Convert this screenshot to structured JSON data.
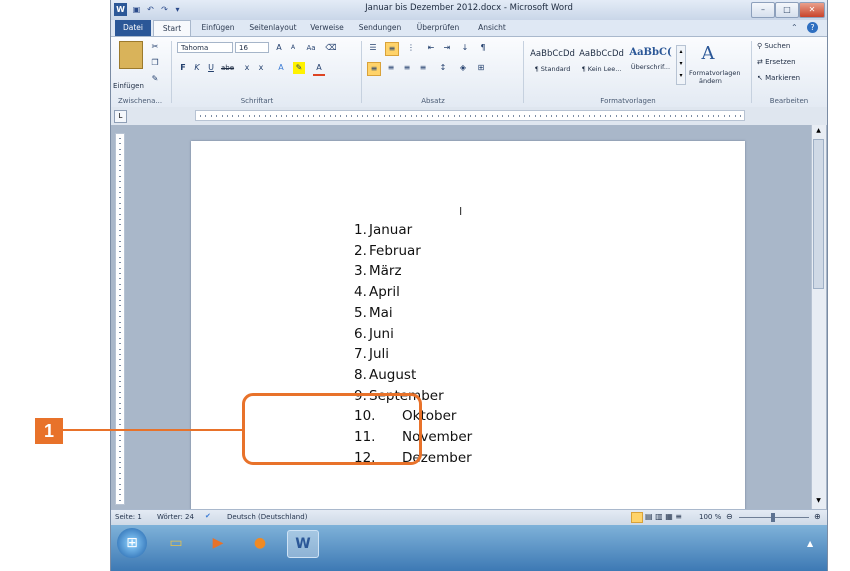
{
  "window": {
    "title": "Januar bis Dezember 2012.docx - Microsoft Word",
    "controls": [
      "–",
      "□",
      "✕"
    ]
  },
  "tabs": [
    "Datei",
    "Start",
    "Einfügen",
    "Seitenlayout",
    "Verweise",
    "Sendungen",
    "Überprüfen",
    "Ansicht"
  ],
  "ribbon": {
    "clipboard": {
      "paste_label": "Einfügen",
      "group_label": "Zwischena..."
    },
    "font": {
      "font_name": "Tahoma",
      "font_size": "16",
      "group_label": "Schriftart",
      "bold": "F",
      "italic": "K",
      "underline": "U",
      "strike": "abe"
    },
    "paragraph": {
      "group_label": "Absatz"
    },
    "styles": {
      "items": [
        {
          "preview": "AaBbCcDd",
          "name": "¶ Standard"
        },
        {
          "preview": "AaBbCcDd",
          "name": "¶ Kein Lee..."
        },
        {
          "preview": "AaBbC(",
          "name": "Überschrif..."
        }
      ],
      "change_label_1": "Formatvorlagen",
      "change_label_2": "ändern",
      "group_label": "Formatvorlagen"
    },
    "editing": {
      "find": "Suchen",
      "replace": "Ersetzen",
      "select": "Markieren",
      "group_label": "Bearbeiten"
    }
  },
  "document": {
    "items": [
      {
        "num": "1.",
        "text": "Januar"
      },
      {
        "num": "2.",
        "text": "Februar"
      },
      {
        "num": "3.",
        "text": "März"
      },
      {
        "num": "4.",
        "text": "April"
      },
      {
        "num": "5.",
        "text": "Mai"
      },
      {
        "num": "6.",
        "text": "Juni"
      },
      {
        "num": "7.",
        "text": "Juli"
      },
      {
        "num": "8.",
        "text": "August"
      },
      {
        "num": "9.",
        "text": "September"
      },
      {
        "num": "10.",
        "text": "Oktober"
      },
      {
        "num": "11.",
        "text": "November"
      },
      {
        "num": "12.",
        "text": "Dezember"
      }
    ]
  },
  "statusbar": {
    "page": "Seite: 1",
    "words": "Wörter: 24",
    "language": "Deutsch (Deutschland)",
    "zoom": "100 %"
  },
  "callout": {
    "number": "1",
    "color": "#e8722a"
  }
}
